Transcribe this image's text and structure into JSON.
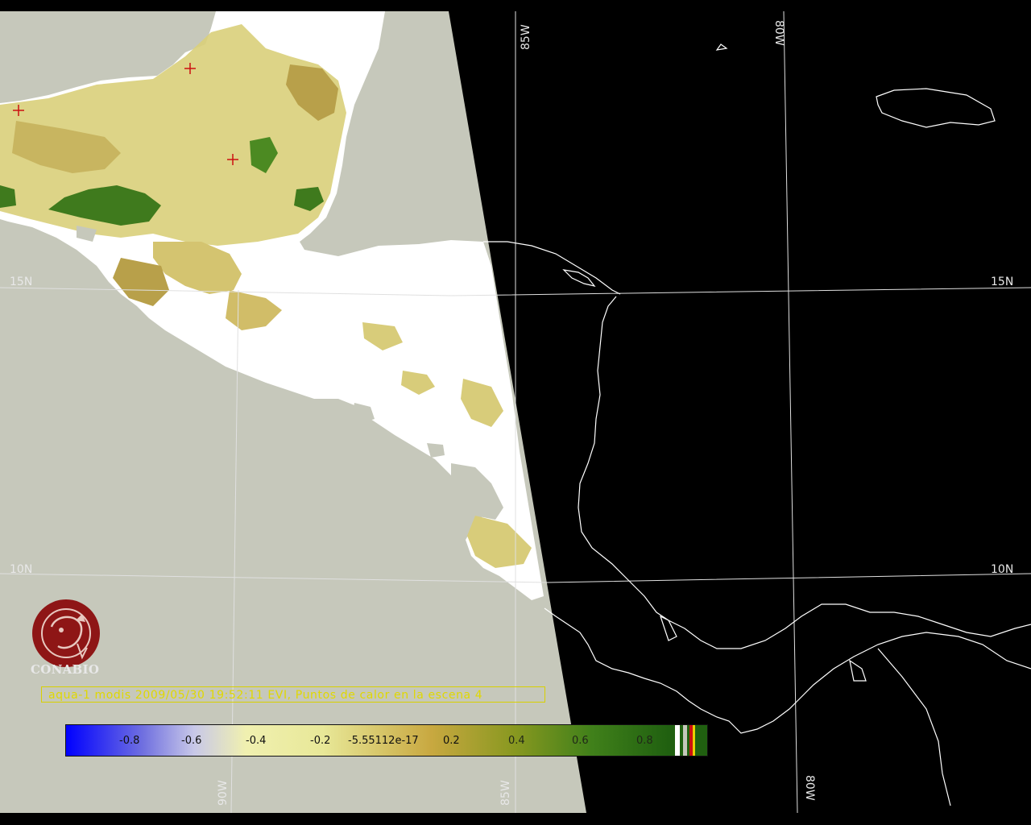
{
  "map": {
    "grid_labels": {
      "lat_15_left": "15N",
      "lat_15_right": "15N",
      "lat_10_left": "10N",
      "lat_10_right": "10N",
      "lon_85_top": "85W",
      "lon_80_top": "80W",
      "lon_90_bottom": "90W",
      "lon_85_bottom": "85W",
      "lon_80_bottom": "80W"
    },
    "caption": "aqua-1 modis 2009/05/30 19:52:11 EVI, Puntos de calor en la escena 4",
    "logo_text": "CONABIO",
    "colors": {
      "no_data": "#c6c8bb",
      "ocean_no_coverage": "#000000",
      "cloud": "#ffffff",
      "coastline": "#ffffff",
      "hotspot": "#cc1010"
    }
  },
  "colorbar": {
    "tick_labels": [
      "-0.8",
      "-0.6",
      "-0.4",
      "-0.2",
      "-5.55112e-17",
      "0.2",
      "0.4",
      "0.6",
      "0.8"
    ],
    "range": [
      -1,
      1
    ]
  }
}
